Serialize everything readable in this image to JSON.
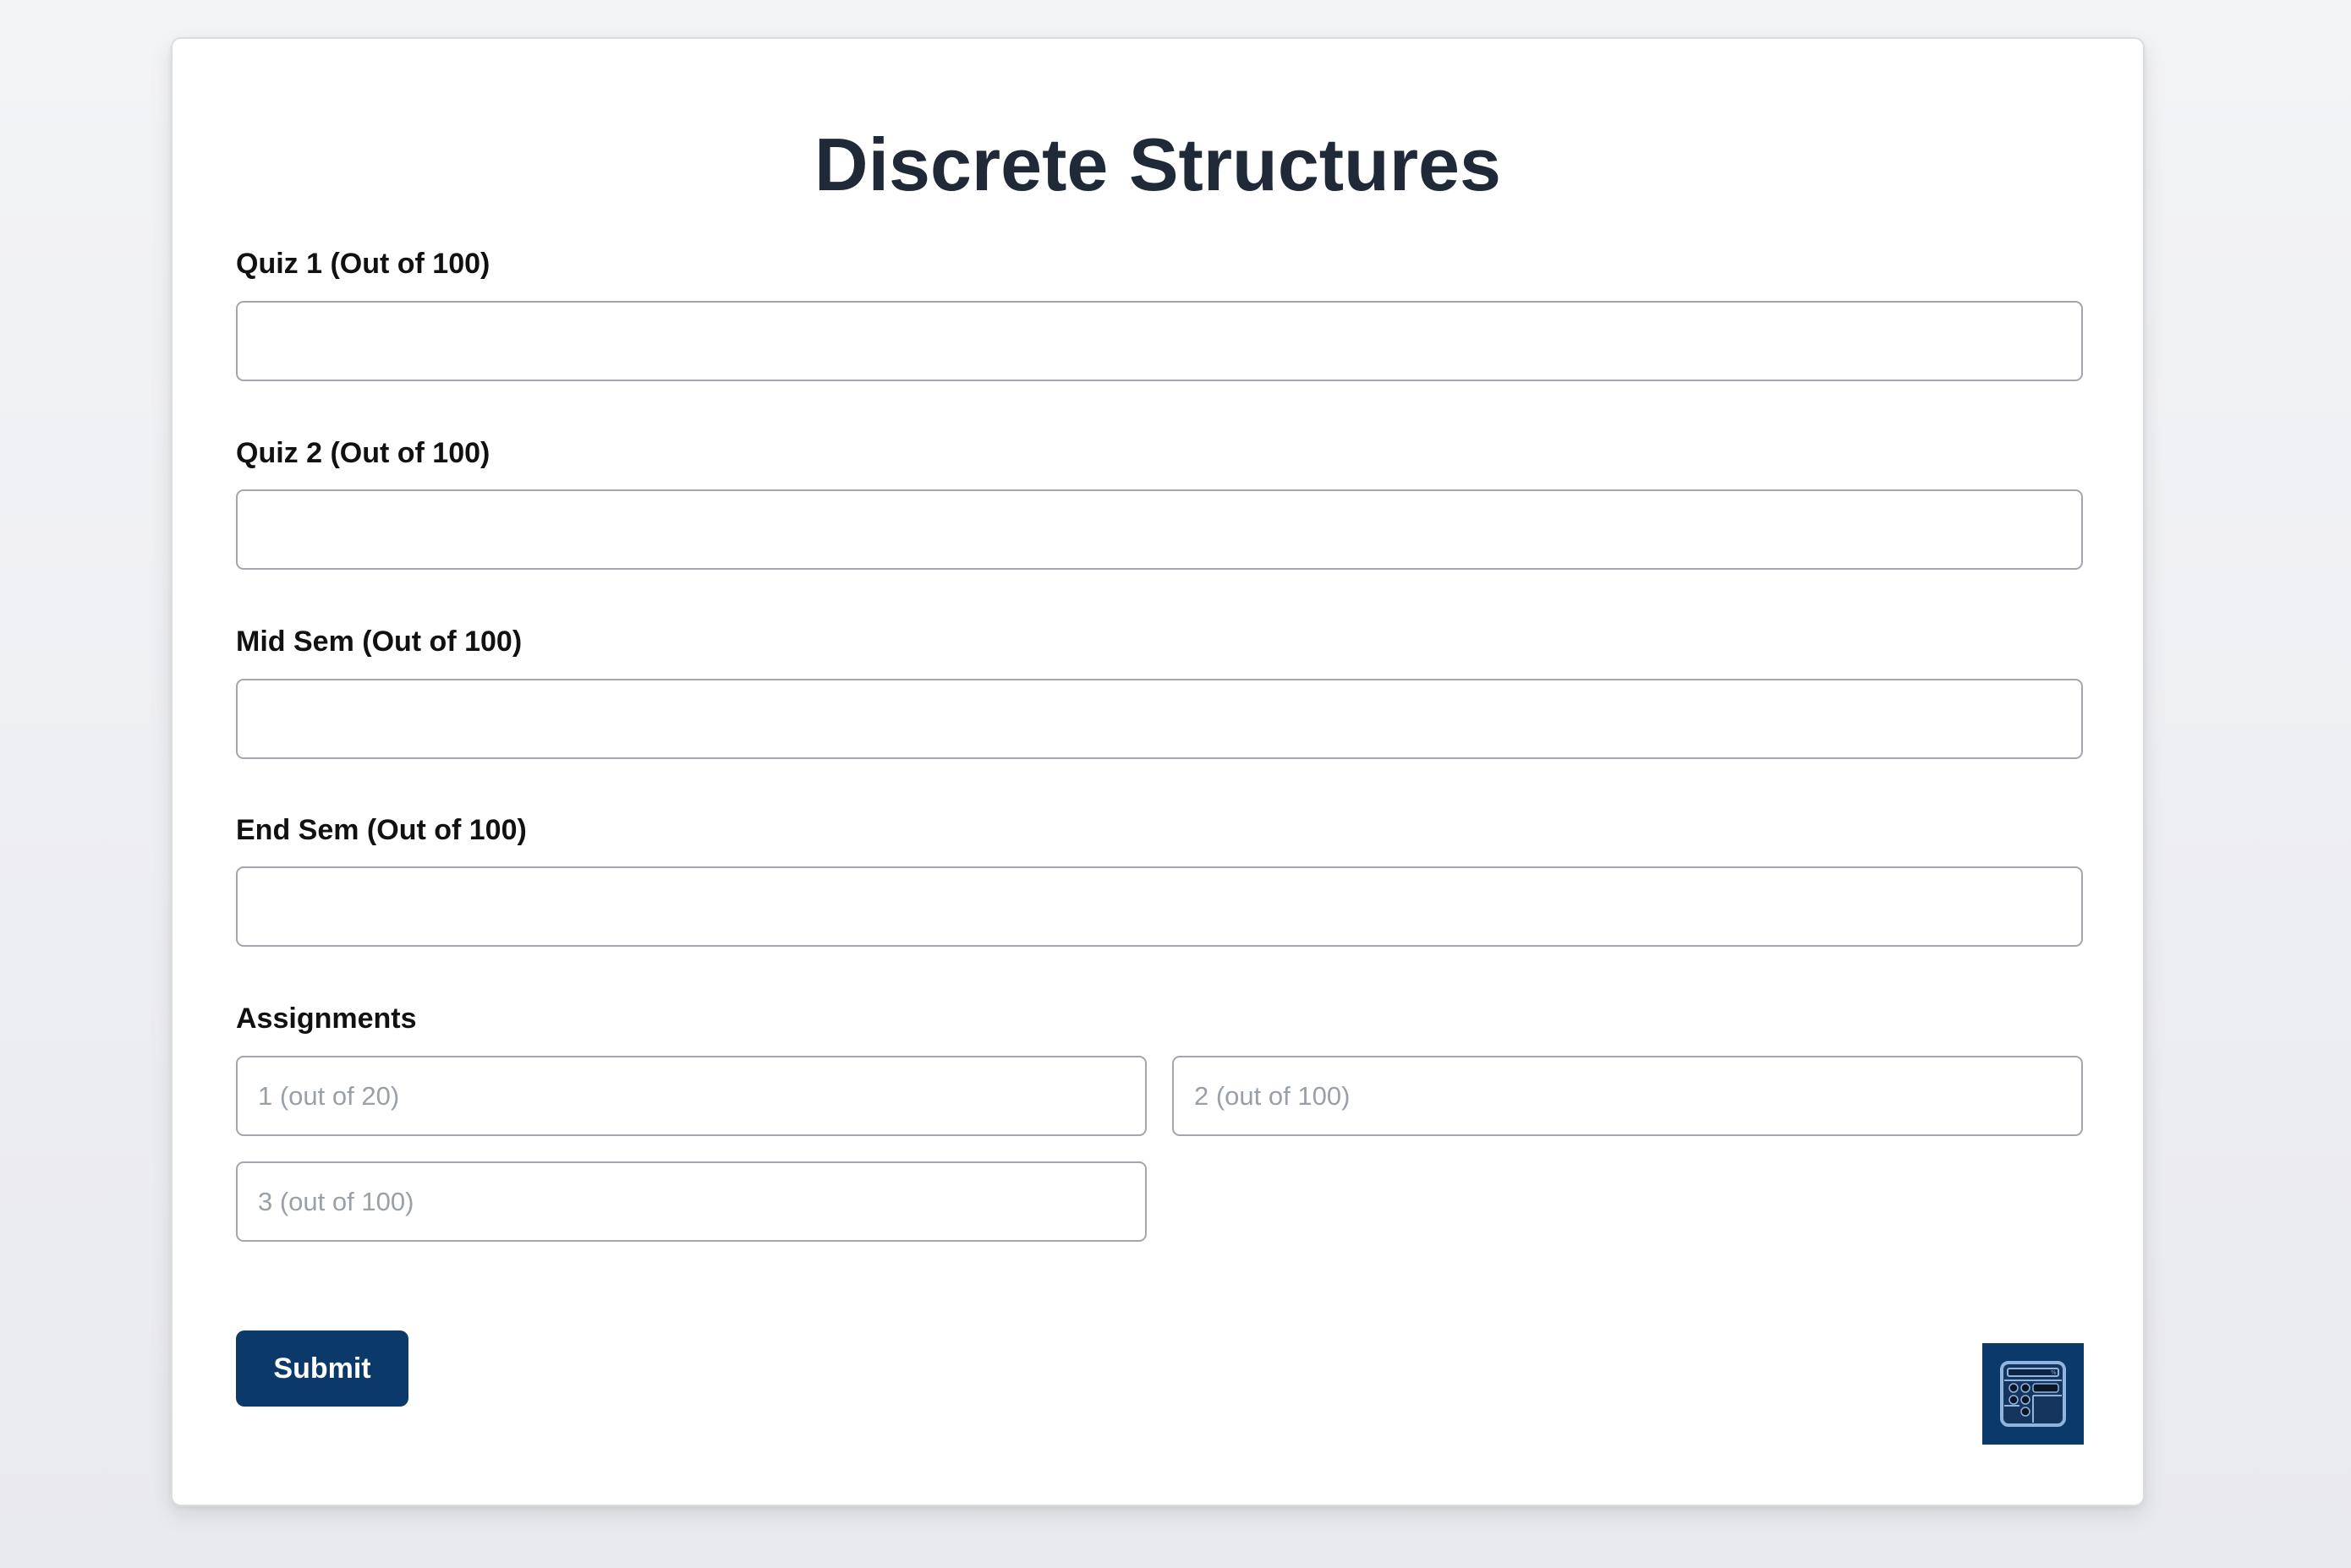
{
  "page": {
    "title": "Discrete Structures"
  },
  "form": {
    "quiz1": {
      "label": "Quiz 1 (Out of 100)",
      "value": "",
      "placeholder": ""
    },
    "quiz2": {
      "label": "Quiz 2 (Out of 100)",
      "value": "",
      "placeholder": ""
    },
    "midsem": {
      "label": "Mid Sem (Out of 100)",
      "value": "",
      "placeholder": ""
    },
    "endsem": {
      "label": "End Sem (Out of 100)",
      "value": "",
      "placeholder": ""
    },
    "assignments": {
      "label": "Assignments",
      "items": [
        {
          "placeholder": "1 (out of 20)",
          "value": ""
        },
        {
          "placeholder": "2 (out of 100)",
          "value": ""
        },
        {
          "placeholder": "3 (out of 100)",
          "value": ""
        }
      ]
    },
    "submit_label": "Submit"
  },
  "calculator_button": {
    "icon": "calculator-icon"
  },
  "colors": {
    "primary": "#0b3a6a",
    "title": "#1f2937",
    "input_border": "#a3a6ad",
    "placeholder": "#9aa0a8",
    "background": "#f3f4f6",
    "card": "#ffffff"
  }
}
